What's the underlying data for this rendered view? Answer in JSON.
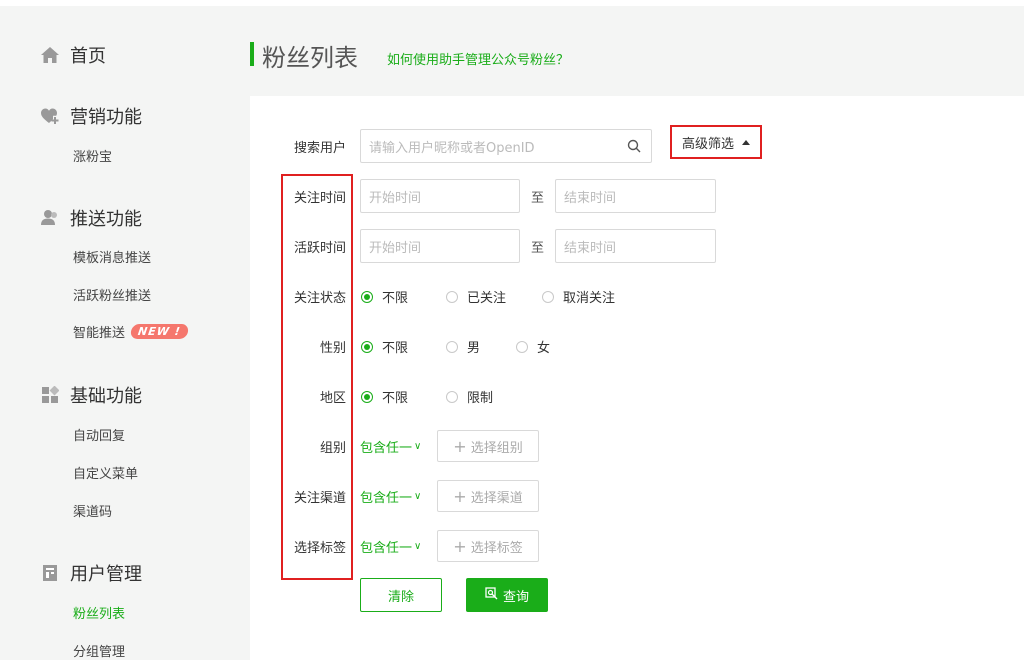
{
  "sidebar": {
    "home": {
      "label": "首页",
      "icon": "home-icon"
    },
    "groups": [
      {
        "label": "营销功能",
        "icon": "heart-plus-icon",
        "items": [
          {
            "label": "涨粉宝"
          }
        ]
      },
      {
        "label": "推送功能",
        "icon": "users-icon",
        "items": [
          {
            "label": "模板消息推送"
          },
          {
            "label": "活跃粉丝推送"
          },
          {
            "label": "智能推送",
            "badge": "NEW !"
          }
        ]
      },
      {
        "label": "基础功能",
        "icon": "grid-icon",
        "items": [
          {
            "label": "自动回复"
          },
          {
            "label": "自定义菜单"
          },
          {
            "label": "渠道码"
          }
        ]
      },
      {
        "label": "用户管理",
        "icon": "document-icon",
        "items": [
          {
            "label": "粉丝列表",
            "active": true
          },
          {
            "label": "分组管理"
          }
        ]
      }
    ]
  },
  "header": {
    "title": "粉丝列表",
    "help_link": "如何使用助手管理公众号粉丝？"
  },
  "filters": {
    "search": {
      "label": "搜索用户",
      "placeholder": "请输入用户昵称或者OpenID"
    },
    "advanced_label": "高级筛选",
    "follow_time": {
      "label": "关注时间",
      "start_placeholder": "开始时间",
      "to": "至",
      "end_placeholder": "结束时间"
    },
    "active_time": {
      "label": "活跃时间",
      "start_placeholder": "开始时间",
      "to": "至",
      "end_placeholder": "结束时间"
    },
    "follow_status": {
      "label": "关注状态",
      "options": [
        "不限",
        "已关注",
        "取消关注"
      ],
      "selected": "不限"
    },
    "gender": {
      "label": "性别",
      "options": [
        "不限",
        "男",
        "女"
      ],
      "selected": "不限"
    },
    "region": {
      "label": "地区",
      "options": [
        "不限",
        "限制"
      ],
      "selected": "不限"
    },
    "group": {
      "label": "组别",
      "mode": "包含任一",
      "button": "选择组别"
    },
    "channel": {
      "label": "关注渠道",
      "mode": "包含任一",
      "button": "选择渠道"
    },
    "tags": {
      "label": "选择标签",
      "mode": "包含任一",
      "button": "选择标签"
    }
  },
  "actions": {
    "clear": "清除",
    "query": "查询"
  },
  "colors": {
    "accent": "#1aad19",
    "highlight": "#e02020",
    "badge": "#f5776d"
  }
}
